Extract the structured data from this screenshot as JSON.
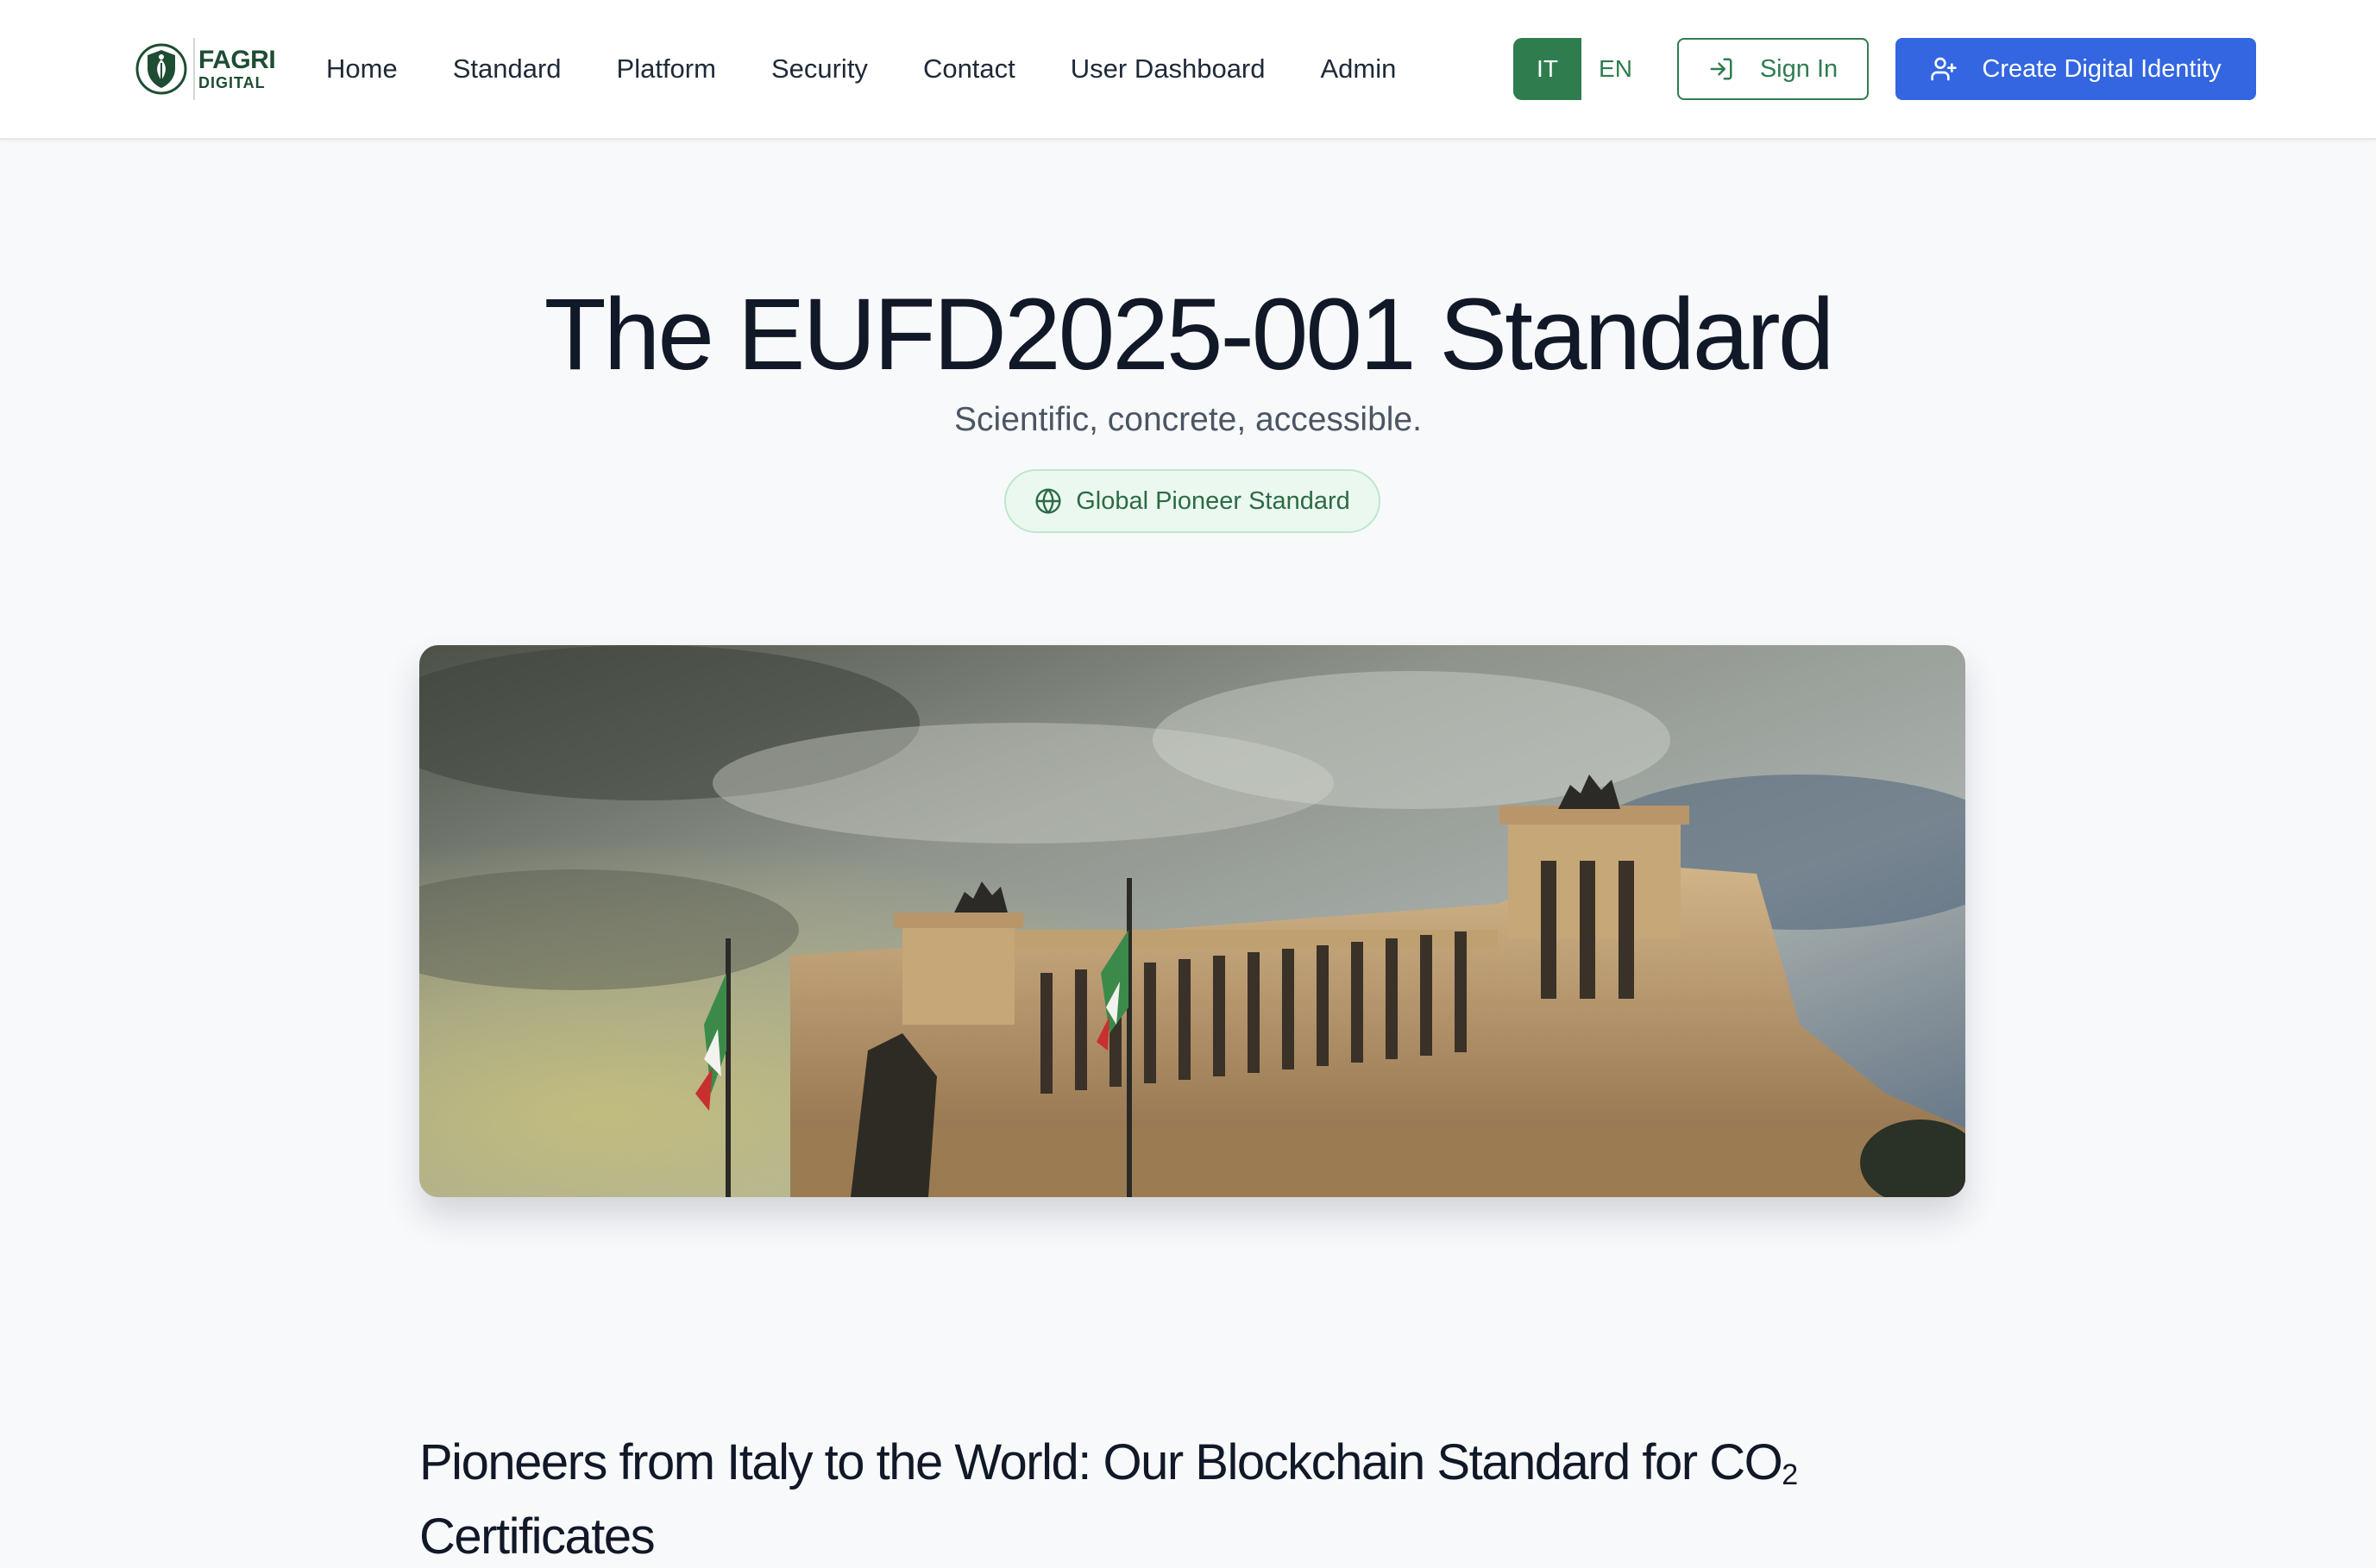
{
  "brand": {
    "line1": "FAGRI",
    "line2": "DIGITAL",
    "icon": "shield-leaf-logo",
    "color": "#1e4d33"
  },
  "nav": {
    "items": [
      {
        "label": "Home"
      },
      {
        "label": "Standard"
      },
      {
        "label": "Platform"
      },
      {
        "label": "Security"
      },
      {
        "label": "Contact"
      },
      {
        "label": "User Dashboard"
      },
      {
        "label": "Admin"
      }
    ]
  },
  "language": {
    "options": [
      "IT",
      "EN"
    ],
    "selected": "IT",
    "accent": "#2f7d4f"
  },
  "actions": {
    "sign_in": {
      "label": "Sign In",
      "icon": "sign-in-icon"
    },
    "create": {
      "label": "Create Digital Identity",
      "icon": "user-plus-icon",
      "color": "#3366e0"
    }
  },
  "hero": {
    "title": "The EUFD2025-001 Standard",
    "subtitle": "Scientific, concrete, accessible.",
    "badge": {
      "label": "Global Pioneer Standard",
      "icon": "globe-icon"
    }
  },
  "image": {
    "icon": "monument-photo"
  },
  "section": {
    "title_main": "Pioneers from Italy to the World: Our Blockchain Standard for CO",
    "title_sub": "2",
    "title_end": "Certificates"
  }
}
